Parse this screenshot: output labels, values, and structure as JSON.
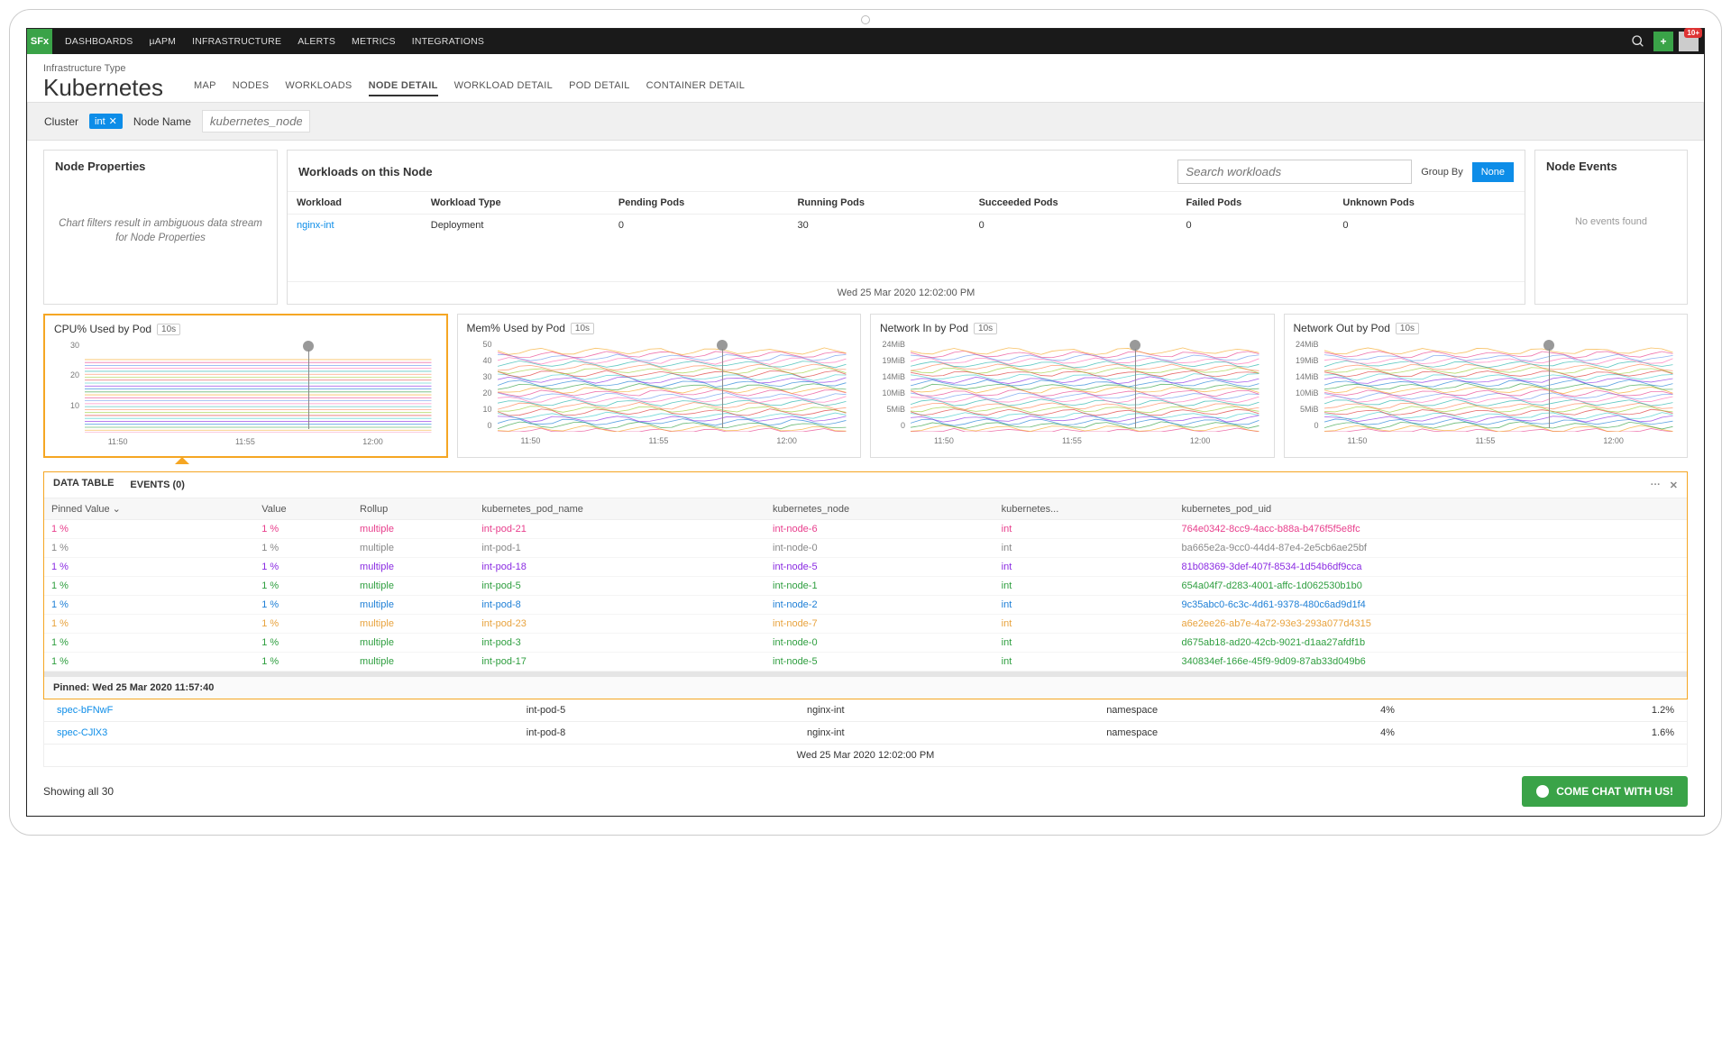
{
  "topnav": {
    "logo": "SFx",
    "items": [
      "DASHBOARDS",
      "µAPM",
      "INFRASTRUCTURE",
      "ALERTS",
      "METRICS",
      "INTEGRATIONS"
    ],
    "notification_badge": "10+"
  },
  "page": {
    "subtitle": "Infrastructure Type",
    "title": "Kubernetes"
  },
  "subtabs": [
    "MAP",
    "NODES",
    "WORKLOADS",
    "NODE DETAIL",
    "WORKLOAD DETAIL",
    "POD DETAIL",
    "CONTAINER DETAIL"
  ],
  "subtabs_active": "NODE DETAIL",
  "filter": {
    "cluster_label": "Cluster",
    "cluster_value": "int",
    "node_name_label": "Node Name",
    "node_name_placeholder": "kubernetes_node"
  },
  "node_properties": {
    "title": "Node Properties",
    "message": "Chart filters result in ambiguous data stream for Node Properties"
  },
  "workloads_panel": {
    "title": "Workloads on this Node",
    "search_placeholder": "Search workloads",
    "groupby_label": "Group By",
    "groupby_button": "None",
    "columns": [
      "Workload",
      "Workload Type",
      "Pending Pods",
      "Running Pods",
      "Succeeded Pods",
      "Failed Pods",
      "Unknown Pods"
    ],
    "rows": [
      {
        "workload": "nginx-int",
        "type": "Deployment",
        "pending": "0",
        "running": "30",
        "succeeded": "0",
        "failed": "0",
        "unknown": "0"
      }
    ],
    "timestamp": "Wed 25 Mar 2020 12:02:00 PM"
  },
  "node_events": {
    "title": "Node Events",
    "empty": "No events found"
  },
  "charts": [
    {
      "title": "CPU% Used by Pod",
      "badge": "10s",
      "yticks": [
        "30",
        "20",
        "10",
        ""
      ],
      "xticks": [
        "11:50",
        "11:55",
        "12:00"
      ],
      "selected": true
    },
    {
      "title": "Mem% Used by Pod",
      "badge": "10s",
      "yticks": [
        "50",
        "40",
        "30",
        "20",
        "10",
        "0"
      ],
      "xticks": [
        "11:50",
        "11:55",
        "12:00"
      ]
    },
    {
      "title": "Network In by Pod",
      "badge": "10s",
      "yticks": [
        "24MiB",
        "19MiB",
        "14MiB",
        "10MiB",
        "5MiB",
        "0"
      ],
      "xticks": [
        "11:50",
        "11:55",
        "12:00"
      ]
    },
    {
      "title": "Network Out by Pod",
      "badge": "10s",
      "yticks": [
        "24MiB",
        "19MiB",
        "14MiB",
        "10MiB",
        "5MiB",
        "0"
      ],
      "xticks": [
        "11:50",
        "11:55",
        "12:00"
      ]
    }
  ],
  "chart_data": [
    {
      "type": "line",
      "title": "CPU% Used by Pod",
      "xlabel": "",
      "ylabel": "%",
      "ylim": [
        0,
        30
      ],
      "x": [
        "11:50",
        "11:55",
        "12:00"
      ],
      "series_count": 30,
      "note": "~30 flat pod series each ≈1% stacked"
    },
    {
      "type": "area",
      "title": "Mem% Used by Pod",
      "ylim": [
        0,
        50
      ],
      "x": [
        "11:50",
        "11:55",
        "12:00"
      ],
      "series_count": 30
    },
    {
      "type": "area",
      "title": "Network In by Pod",
      "ylim": [
        0,
        24
      ],
      "yunit": "MiB",
      "x": [
        "11:50",
        "11:55",
        "12:00"
      ],
      "series_count": 30
    },
    {
      "type": "area",
      "title": "Network Out by Pod",
      "ylim": [
        0,
        24
      ],
      "yunit": "MiB",
      "x": [
        "11:50",
        "11:55",
        "12:00"
      ],
      "series_count": 30
    }
  ],
  "data_tabs": {
    "tab1": "DATA TABLE",
    "tab2": "EVENTS (0)",
    "more": "···",
    "close": "✕"
  },
  "data_table": {
    "headers": [
      "Pinned Value ⌄",
      "Value",
      "Rollup",
      "kubernetes_pod_name",
      "kubernetes_node",
      "kubernetes...",
      "kubernetes_pod_uid"
    ],
    "rows": [
      {
        "color": "c-pink",
        "pv": "1 %",
        "v": "1 %",
        "r": "multiple",
        "pod": "int-pod-21",
        "node": "int-node-6",
        "k": "int",
        "uid": "764e0342-8cc9-4acc-b88a-b476f5f5e8fc"
      },
      {
        "color": "c-gray",
        "pv": "1 %",
        "v": "1 %",
        "r": "multiple",
        "pod": "int-pod-1",
        "node": "int-node-0",
        "k": "int",
        "uid": "ba665e2a-9cc0-44d4-87e4-2e5cb6ae25bf"
      },
      {
        "color": "c-purple",
        "pv": "1 %",
        "v": "1 %",
        "r": "multiple",
        "pod": "int-pod-18",
        "node": "int-node-5",
        "k": "int",
        "uid": "81b08369-3def-407f-8534-1d54b6df9cca"
      },
      {
        "color": "c-green",
        "pv": "1 %",
        "v": "1 %",
        "r": "multiple",
        "pod": "int-pod-5",
        "node": "int-node-1",
        "k": "int",
        "uid": "654a04f7-d283-4001-affc-1d062530b1b0"
      },
      {
        "color": "c-blue",
        "pv": "1 %",
        "v": "1 %",
        "r": "multiple",
        "pod": "int-pod-8",
        "node": "int-node-2",
        "k": "int",
        "uid": "9c35abc0-6c3c-4d61-9378-480c6ad9d1f4"
      },
      {
        "color": "c-orange",
        "pv": "1 %",
        "v": "1 %",
        "r": "multiple",
        "pod": "int-pod-23",
        "node": "int-node-7",
        "k": "int",
        "uid": "a6e2ee26-ab7e-4a72-93e3-293a077d4315"
      },
      {
        "color": "c-green",
        "pv": "1 %",
        "v": "1 %",
        "r": "multiple",
        "pod": "int-pod-3",
        "node": "int-node-0",
        "k": "int",
        "uid": "d675ab18-ad20-42cb-9021-d1aa27afdf1b"
      },
      {
        "color": "c-green",
        "pv": "1 %",
        "v": "1 %",
        "r": "multiple",
        "pod": "int-pod-17",
        "node": "int-node-5",
        "k": "int",
        "uid": "340834ef-166e-45f9-9d09-87ab33d049b6"
      }
    ],
    "pinned_label": "Pinned: Wed 25 Mar 2020 11:57:40"
  },
  "bottom_rows": [
    {
      "spec": "spec-bFNwF",
      "pod": "int-pod-5",
      "wl": "nginx-int",
      "ns": "namespace",
      "pct": "4%",
      "val": "1.2%"
    },
    {
      "spec": "spec-CJlX3",
      "pod": "int-pod-8",
      "wl": "nginx-int",
      "ns": "namespace",
      "pct": "4%",
      "val": "1.6%"
    }
  ],
  "bottom_timestamp": "Wed 25 Mar 2020 12:02:00 PM",
  "footer": {
    "showing": "Showing all 30",
    "chat": "COME CHAT WITH US!"
  }
}
